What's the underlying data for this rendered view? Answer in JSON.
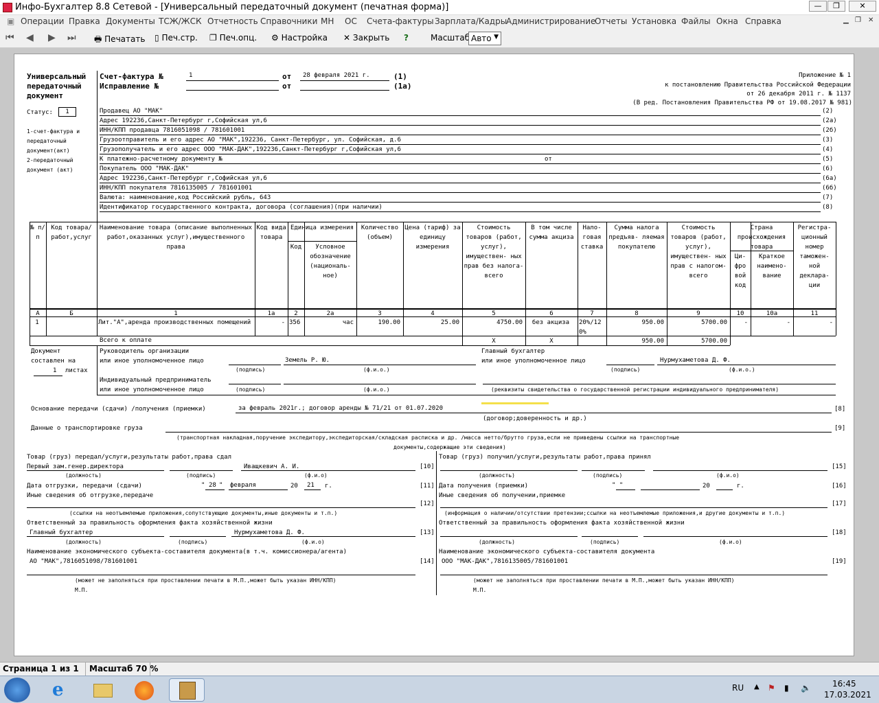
{
  "window": {
    "title": "Инфо-Бухгалтер 8.8 Сетевой - [Универсальный передаточный документ (печатная форма)]",
    "min": "—",
    "max": "❐",
    "close": "✕"
  },
  "menu": [
    "Операции",
    "Правка",
    "Документы",
    "ТСЖ/ЖСК",
    "Отчетность",
    "Справочники",
    "МН",
    "ОС",
    "Счета-фактуры",
    "Зарплата/Кадры",
    "Администрирование",
    "Отчеты",
    "Установка",
    "Файлы",
    "Окна",
    "Справка"
  ],
  "toolbar": {
    "print": "Печатать",
    "print_page": "Печ.стр.",
    "print_opt": "Печ.опц.",
    "settings": "Настройка",
    "close": "Закрыть",
    "help": "?",
    "scale_label": "Масштаб:",
    "scale_value": "Авто"
  },
  "doc": {
    "header_left": [
      "Универсальный",
      "передаточный",
      "документ"
    ],
    "sf_label": "Счет-фактура №",
    "sf_num": "1",
    "from": "от",
    "sf_date": "28 февраля 2021 г.",
    "sf_code": "(1)",
    "fix_label": "Исправление №",
    "fix_code": "(1а)",
    "appendix": [
      "Приложение № 1",
      "к постановлению Правительства Российской Федерации",
      "от 26 декабря 2011 г. № 1137",
      "(В ред. Постановления Правительства РФ от 19.08.2017 № 981)"
    ],
    "status_label": "Статус:",
    "status_value": "1",
    "status_notes": [
      "1-счет-фактура и",
      "передаточный",
      "документ(акт)",
      "2-передаточный",
      "документ (акт)"
    ],
    "lines": [
      {
        "text": "Продавец АО \"МАК\"",
        "code": "(2)"
      },
      {
        "text": "Адрес 192236,Санкт-Петербург г,Софийская ул,6",
        "code": "(2а)"
      },
      {
        "text": "ИНН/КПП продавца 7816051098 / 781601001",
        "code": "(2б)"
      },
      {
        "text": "Грузоотправитель и его адрес АО \"МАК\",192236, Санкт-Петербург, ул. Софийская, д.6",
        "code": "(3)"
      },
      {
        "text": "Грузополучатель и его адрес  ООО \"МАК-ДАК\",192236,Санкт-Петербург г,Софийская ул,6",
        "code": "(4)"
      },
      {
        "text": "К платежно-расчетному документу №",
        "code": "(5)",
        "extra": "от"
      },
      {
        "text": "Покупатель ООО \"МАК-ДАК\"",
        "code": "(6)"
      },
      {
        "text": "Адрес 192236,Санкт-Петербург г,Софийская ул,6",
        "code": "(6а)"
      },
      {
        "text": "ИНН/КПП покупателя 7816135005 / 781601001",
        "code": "(6б)"
      },
      {
        "text": "Валюта: наименование,код Российский рубль, 643",
        "code": "(7)"
      },
      {
        "text": "Идентификатор государственного контракта, договора (соглашения)(при наличии)",
        "code": "(8)"
      }
    ],
    "cols": {
      "c1": "№ п/п",
      "c2": "Код товара/ работ,услуг",
      "c3": "Наименование товара (описание выполненных работ,оказанных услуг),имущественного права",
      "c4": "Код вида товара",
      "c5": "Единица измерения",
      "c5a": "Код",
      "c5b": "Условное обозначение (националь- ное)",
      "c6": "Количество (объем)",
      "c7": "Цена (тариф) за единицу измерения",
      "c8": "Стоимость товаров (работ, услуг), имуществен- ных прав без налога- всего",
      "c9": "В том числе сумма акциза",
      "c10": "Нало- говая ставка",
      "c11": "Сумма налога предъяв- ляемая покупателю",
      "c12": "Стоимость товаров (работ, услуг), имуществен- ных прав с налогом- всего",
      "c13": "Страна происхождения товара",
      "c13a": "Ци- фро вой код",
      "c13b": "Краткое наимено- вание",
      "c14": "Регистра- ционный номер таможен- ной деклара- ции"
    },
    "col_nums": [
      "А",
      "Б",
      "1",
      "1а",
      "2",
      "2а",
      "3",
      "4",
      "5",
      "6",
      "7",
      "8",
      "9",
      "10",
      "10а",
      "11"
    ],
    "row": {
      "n": "1",
      "code": "",
      "name": "Лит.\"А\",аренда производственных помещений",
      "kind": "-",
      "ucode": "356",
      "uname": "час",
      "qty": "190.00",
      "price": "25.00",
      "sum": "4750.00",
      "excise": "без акциза",
      "rate": "20%/12 0%",
      "tax": "950.00",
      "total": "5700.00",
      "cc": "-",
      "cn": "-",
      "decl": "-"
    },
    "total_row": {
      "label": "Всего к оплате",
      "x1": "Х",
      "x2": "Х",
      "tax": "950.00",
      "total": "5700.00"
    },
    "left_block": [
      "Документ",
      "составлен на",
      "1",
      "листах"
    ],
    "sign": {
      "head": [
        "Руководитель организации",
        "или иное уполномоченное лицо"
      ],
      "head_name": "Земель Р. Ю.",
      "acc": [
        "Главный бухгалтер",
        "или иное уполномоченное лицо"
      ],
      "acc_name": "Нурмухаметова Д. Ф.",
      "ip": [
        "Индивидуальный предприниматель",
        "или иное уполномоченное лицо"
      ],
      "podp": "(подпись)",
      "fio": "(ф.и.о.)",
      "rekv": "(реквизиты свидетельства о государственной регистрации индивидуального предпринимателя)"
    },
    "basis_label": "Основание передачи (сдачи) /получения (приемки)",
    "basis_value": "за февраль 2021г.; договор аренды № 71/21 от 01.07.2020",
    "basis_code": "[8]",
    "basis_hint": "(договор;доверенность и др.)",
    "transport_label": "Данные о транспортировке груза",
    "transport_code": "[9]",
    "transport_hint": "(транспортная накладная,поручение экспедитору,экспедиторская/складская расписка и др. /масса нетто/брутто груза,если не приведены ссылки на транспортные",
    "transport_hint2": "документы,содержащие эти сведения)",
    "left": {
      "l1": "Товар (груз) передал/услуги,результаты работ,права сдал",
      "pos": "Первый зам.генер.директора",
      "name": "Иващкевич А. И.",
      "c10": "[10]",
      "dolzh": "(должность)",
      "podp": "(подпись)",
      "fio": "(ф.и.о)",
      "date_label": "Дата отгрузки, передачи (сдачи)",
      "q1": "\"",
      "day": "28",
      "q2": "\"",
      "month": "февраля",
      "y20": "20",
      "year": "21",
      "g": "г.",
      "c11": "[11]",
      "other": "Иные сведения об отгрузке,передаче",
      "c12": "[12]",
      "other_hint": "(ссылки на неотъемлемые приложения,сопутствующие документы,иные документы и т.п.)",
      "resp": "Ответственный за правильность оформления факта хозяйственной жизни",
      "resp_pos": "Главный бухгалтер",
      "resp_name": "Нурмухаметова Д. Ф.",
      "c13": "[13]",
      "dolzh2": "(должность)",
      "podp2": "(подпись)",
      "fio2": "(ф.и.о)",
      "subj": "Наименование экономического субъекта-составителя документа(в т.ч. комиссионера/агента)",
      "subj_value": "АО \"МАК\",7816051098/781601001",
      "c14": "[14]",
      "stamp_hint": "(может не заполняться при проставлении печати в М.П.,может быть указан ИНН/КПП)",
      "mp": "М.П."
    },
    "right": {
      "r1": "Товар (груз) получил/услуги,результаты работ,права принял",
      "c15": "[15]",
      "dolzh": "(должность)",
      "podp": "(подпись)",
      "fio": "(ф.и.о)",
      "date_label": "Дата получения (приемки)",
      "q": "\"   \"",
      "y20": "20",
      "g": "г.",
      "c16": "[16]",
      "other": "Иные сведения об получении,приемке",
      "c17": "[17]",
      "other_hint": "(информация о наличии/отсутствии претензии;ссылки на неотъемлемые приложения,и другие документы и т.п.)",
      "resp": "Ответственный за правильность оформления факта хозяйственной жизни",
      "c18": "[18]",
      "dolzh2": "(должность)",
      "podp2": "(подпись)",
      "fio2": "(ф.и.о)",
      "subj": "Наименование экономического субъекта-составителя документа",
      "subj_value": "ООО \"МАК-ДАК\",7816135005/781601001",
      "c19": "[19]",
      "stamp_hint": "(может не заполняться при проставлении печати в М.П.,может быть указан ИНН/КПП)",
      "mp": "М.П."
    }
  },
  "status": {
    "page": "Страница 1 из 1",
    "scale": "Масштаб 70 %"
  },
  "tray": {
    "lang": "RU",
    "time": "16:45",
    "date": "17.03.2021"
  }
}
